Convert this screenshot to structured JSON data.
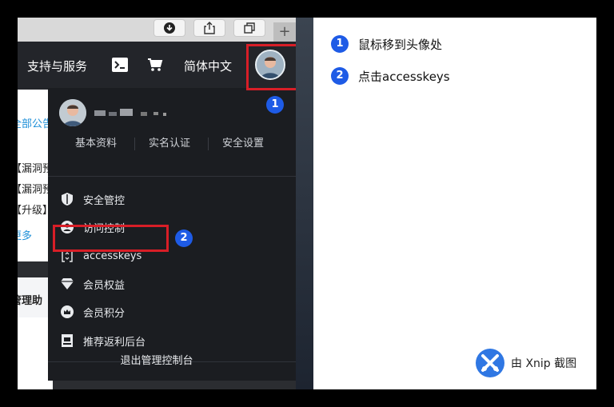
{
  "topnav": {
    "support_label": "支持与服务",
    "language_label": "简体中文"
  },
  "background_page": {
    "tab_label": "全部公告",
    "rows": [
      "【漏洞预",
      "【漏洞预",
      "【升级】"
    ],
    "more_label": "更多",
    "section_label": "管理助"
  },
  "dropdown": {
    "sub_links": [
      "基本资料",
      "实名认证",
      "安全设置"
    ],
    "menu_items": [
      {
        "label": "安全管控",
        "icon": "shield-icon"
      },
      {
        "label": "访问控制",
        "icon": "user-icon"
      },
      {
        "label": "accesskeys",
        "icon": "key-bracket-icon"
      },
      {
        "label": "会员权益",
        "icon": "diamond-icon"
      },
      {
        "label": "会员积分",
        "icon": "crown-icon"
      },
      {
        "label": "推荐返利后台",
        "icon": "gift-icon"
      }
    ],
    "logout_label": "退出管理控制台"
  },
  "badges": {
    "one": "1",
    "two": "2"
  },
  "steps": [
    {
      "num": "1",
      "text": "鼠标移到头像处"
    },
    {
      "num": "2",
      "text": "点击accesskeys"
    }
  ],
  "watermark": {
    "text": "由 Xnip 截图"
  },
  "colors": {
    "highlight": "#d81e27",
    "badge": "#1e5be6",
    "menu_bg": "#1b1d21"
  }
}
